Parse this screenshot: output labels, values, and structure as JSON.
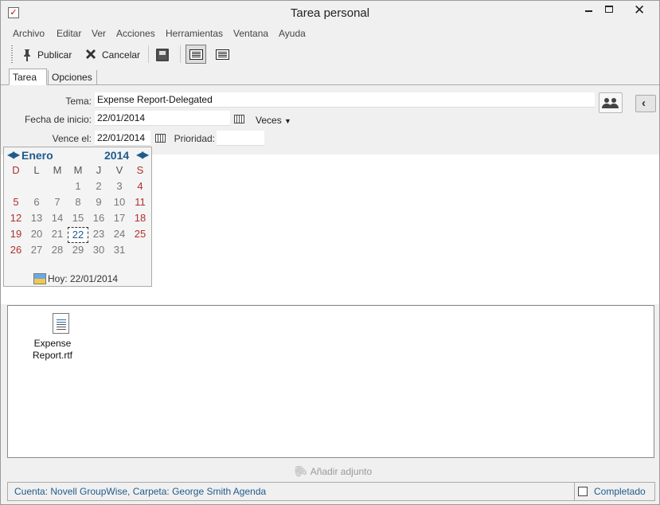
{
  "window": {
    "title": "Tarea personal",
    "close_glyph": "✕"
  },
  "menu": [
    "Archivo",
    "Editar",
    "Ver",
    "Acciones",
    "Herramientas",
    "Ventana",
    "Ayuda"
  ],
  "toolbar": {
    "publish_label": "Publicar",
    "cancel_label": "Cancelar",
    "icons": [
      "pin-icon",
      "x-icon",
      "save-icon",
      "view-icon",
      "view-icon"
    ]
  },
  "tabs": [
    {
      "label": "Tarea",
      "active": true
    },
    {
      "label": "Opciones",
      "active": false
    }
  ],
  "form": {
    "subject_label": "Tema:",
    "subject_value": "Expense Report-Delegated",
    "start_label": "Fecha de inicio:",
    "start_value": "22/01/2014",
    "recurrence_label": "Veces",
    "due_label": "Vence el:",
    "due_value": "22/01/2014",
    "priority_label": "Prioridad:",
    "priority_value": ""
  },
  "calendar": {
    "month": "Enero",
    "year": "2014",
    "day_names": [
      "D",
      "L",
      "M",
      "M",
      "J",
      "V",
      "S"
    ],
    "weeks": [
      [
        "",
        "",
        "",
        "1",
        "2",
        "3",
        "4"
      ],
      [
        "5",
        "6",
        "7",
        "8",
        "9",
        "10",
        "11"
      ],
      [
        "12",
        "13",
        "14",
        "15",
        "16",
        "17",
        "18"
      ],
      [
        "19",
        "20",
        "21",
        "22",
        "23",
        "24",
        "25"
      ],
      [
        "26",
        "27",
        "28",
        "29",
        "30",
        "31",
        ""
      ]
    ],
    "selected_day": "22",
    "today_text": "Hoy: 22/01/2014"
  },
  "attachments": {
    "files": [
      {
        "name": "Expense Report.rtf",
        "icon": "rtf-file-icon"
      }
    ],
    "add_label": "Añadir adjunto"
  },
  "status": {
    "account_text": "Cuenta: Novell GroupWise,  Carpeta: George Smith Agenda",
    "completed_label": "Completado",
    "completed_checked": false
  },
  "colors": {
    "accent": "#1e5b8c",
    "weekend": "#b03030"
  }
}
